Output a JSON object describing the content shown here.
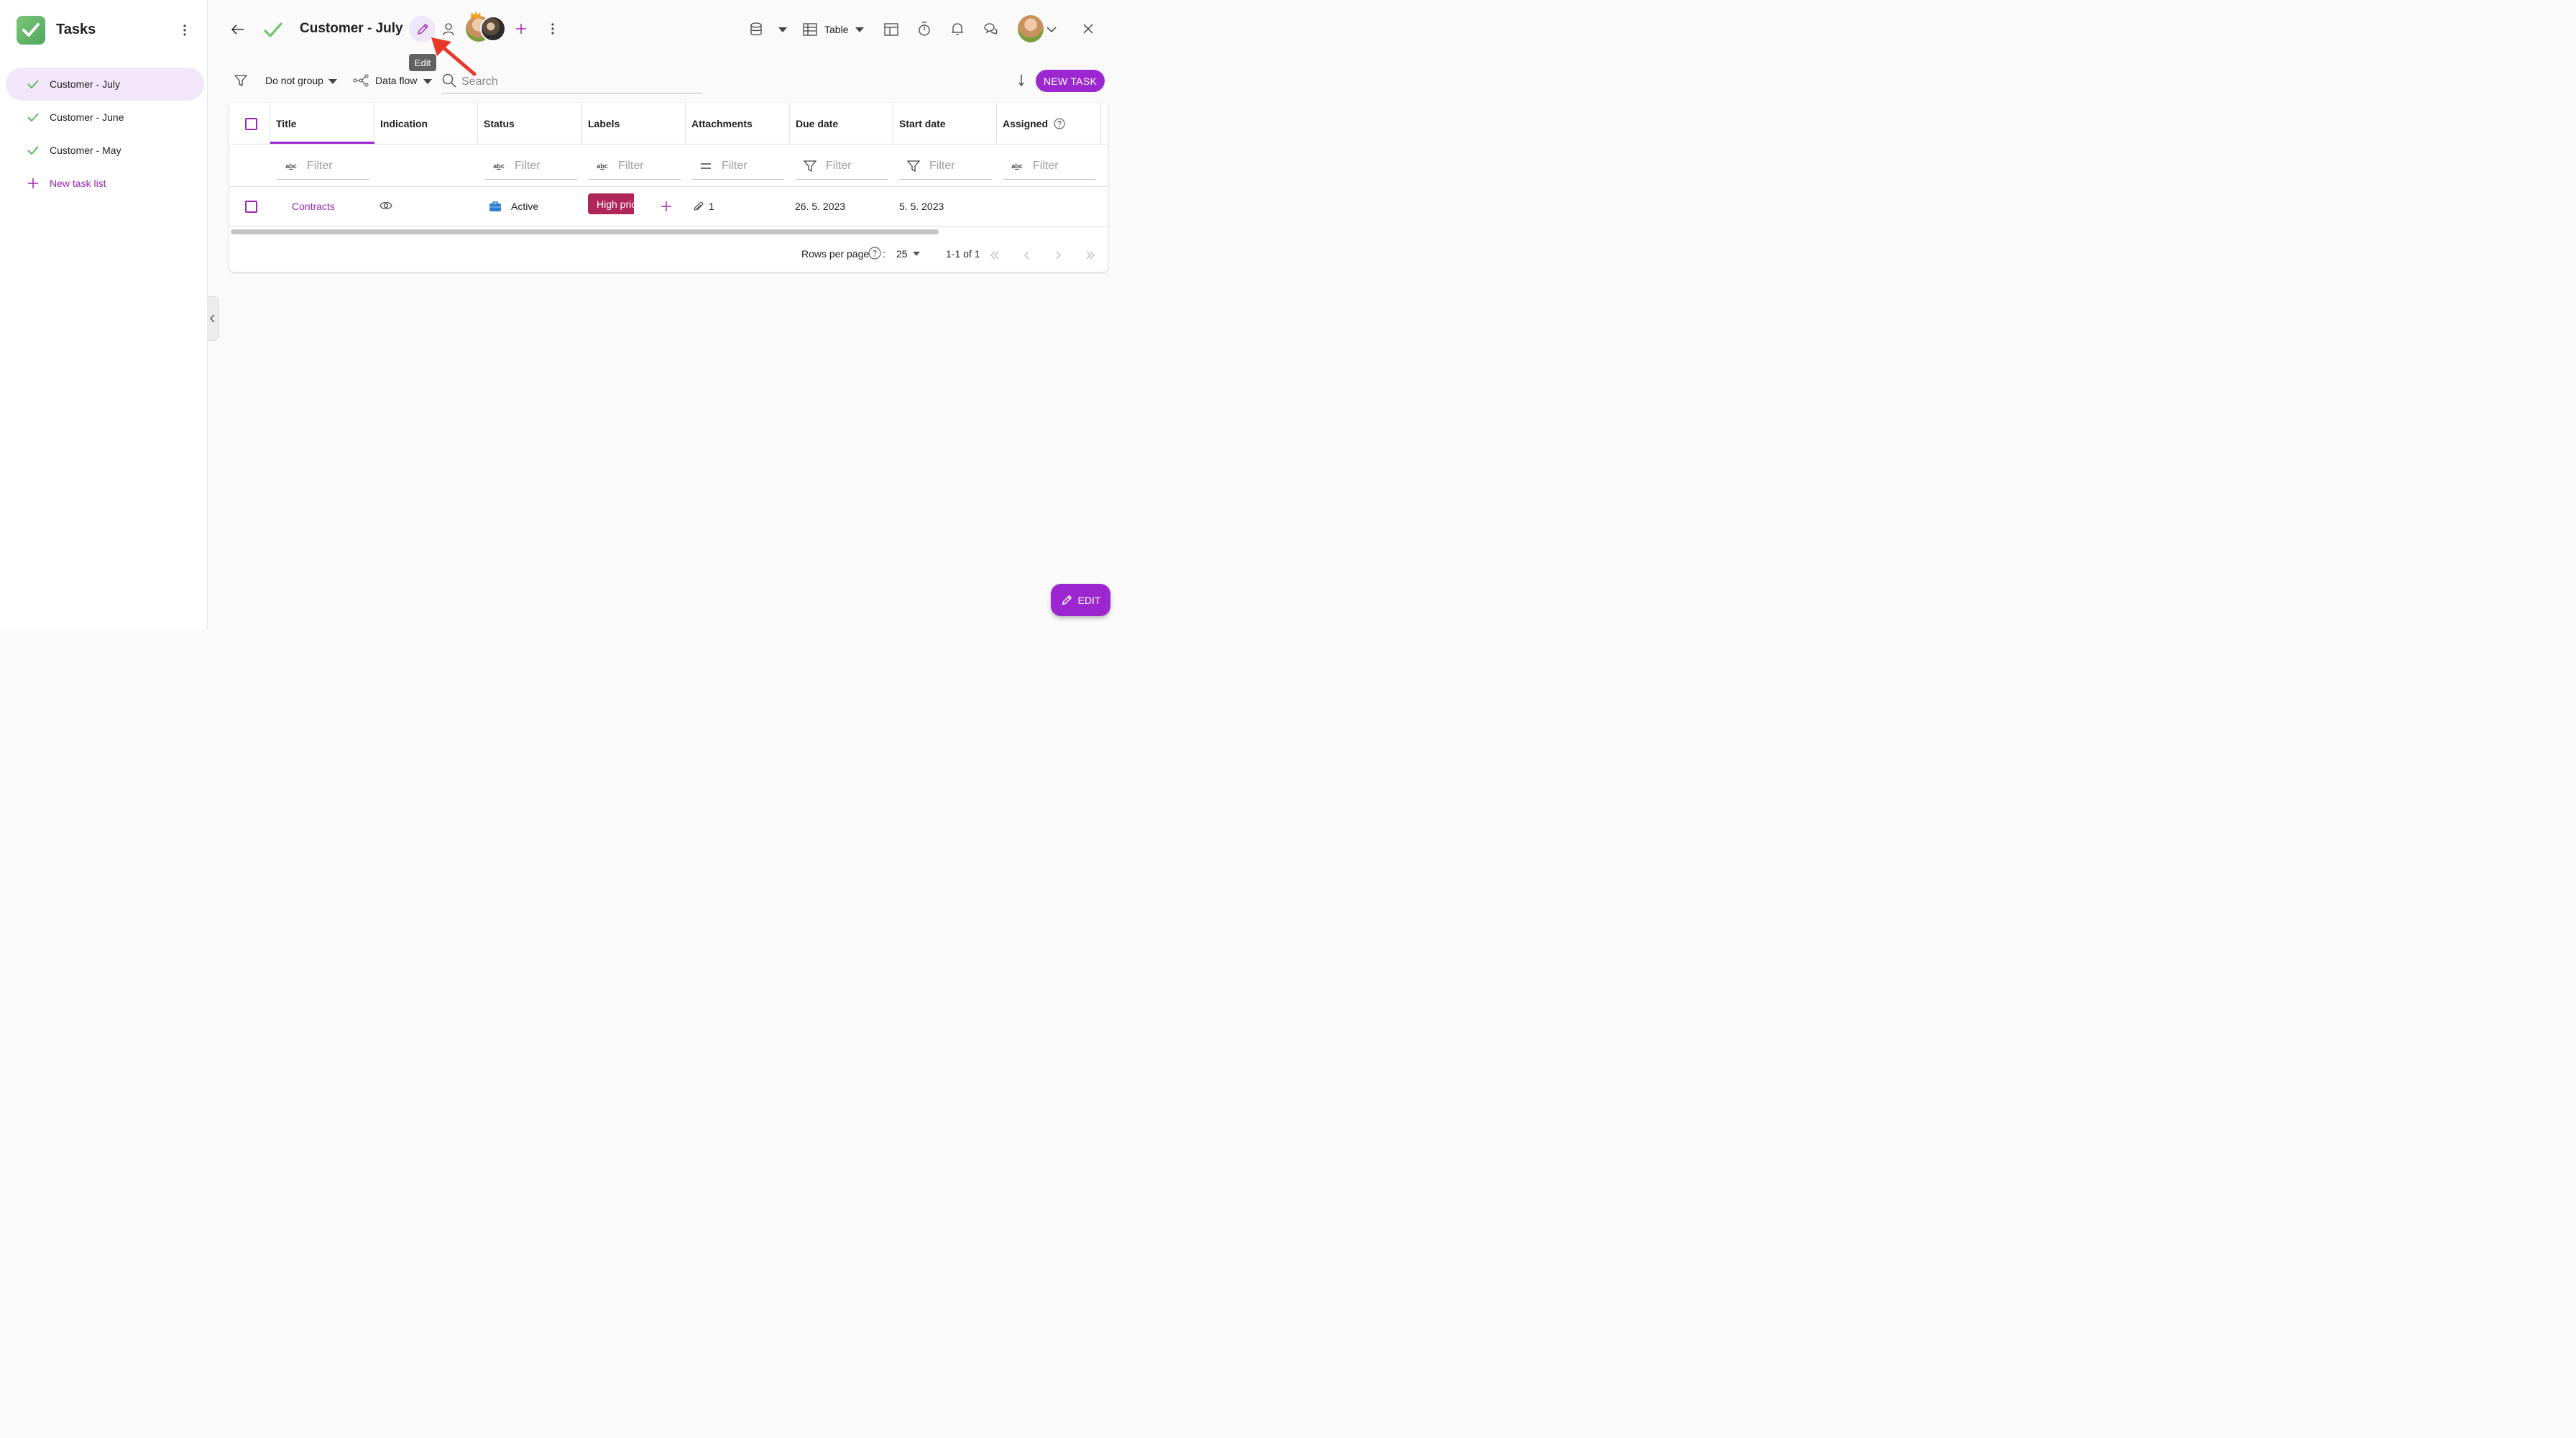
{
  "sidebar": {
    "app_title": "Tasks",
    "items": [
      {
        "label": "Customer - July",
        "active": true
      },
      {
        "label": "Customer - June",
        "active": false
      },
      {
        "label": "Customer - May",
        "active": false
      }
    ],
    "new_list_label": "New task list"
  },
  "header": {
    "title": "Customer - July",
    "edit_tooltip": "Edit",
    "view_label": "Table"
  },
  "filter_bar": {
    "group_label": "Do not group",
    "flow_label": "Data flow",
    "search_placeholder": "Search",
    "new_task_label": "NEW TASK"
  },
  "table": {
    "columns": [
      "Title",
      "Indication",
      "Status",
      "Labels",
      "Attachments",
      "Due date",
      "Start date",
      "Assigned"
    ],
    "filter_placeholder": "Filter",
    "rows": [
      {
        "title": "Contracts",
        "status": "Active",
        "label": "High priority",
        "attachments": "1",
        "due_date": "26. 5. 2023",
        "start_date": "5. 5. 2023"
      }
    ],
    "footer": {
      "rows_per_page_label": "Rows per page",
      "rows_per_page_value": "25",
      "range": "1-1 of 1"
    }
  },
  "fab": {
    "label": "EDIT"
  },
  "colors": {
    "accent": "#9c27d0",
    "tag": "#b0265a",
    "check": "#5cb85c"
  }
}
